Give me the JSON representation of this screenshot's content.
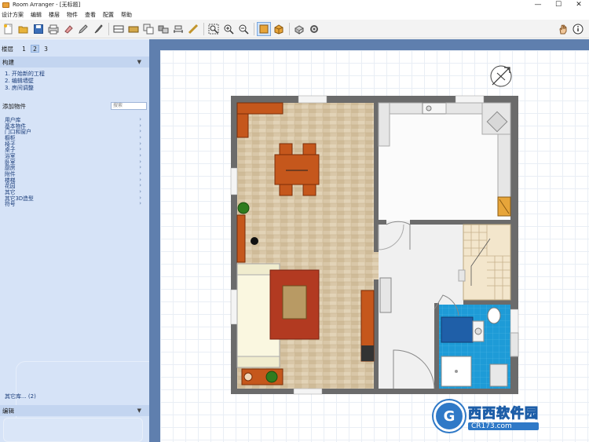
{
  "window": {
    "title": "Room Arranger - [无标题]"
  },
  "controls": {
    "minimize": "—",
    "maximize": "☐",
    "close": "✕"
  },
  "menu": [
    "设计方案",
    "编辑",
    "楼层",
    "物件",
    "查看",
    "帮助",
    "帮助"
  ],
  "menu_labels": {
    "file": "设计方案",
    "edit": "编辑",
    "floor": "楼层",
    "object": "物件",
    "view": "查看",
    "options": "配置",
    "help": "帮助"
  },
  "toolbar": {
    "left_icons": [
      "new-icon",
      "open-icon",
      "save-icon",
      "print-icon",
      "eraser-icon",
      "pencil-icon",
      "brush-icon",
      "wall-icon",
      "floor-tile-icon",
      "copy-icon",
      "group-icon",
      "measure-icon",
      "ruler-icon",
      "zoom-fit-icon",
      "zoom-in-icon",
      "zoom-out-icon",
      "2d-view-icon",
      "3d-view-icon",
      "3d-walk-icon",
      "settings-icon"
    ],
    "right_icons": [
      "hand-icon",
      "info-icon"
    ]
  },
  "sidebar": {
    "floor_label": "楼层",
    "floors": [
      "1",
      "2",
      "3"
    ],
    "active_floor": "2",
    "build_title": "构建",
    "steps": [
      "1.  开始新的工程",
      "2.  编辑墙壁",
      "3.  房间调整"
    ],
    "add_title": "添加物件",
    "search_placeholder": "搜索",
    "categories": [
      "用户库",
      "基本物件",
      "门口和窗户",
      "橱柜",
      "椅子",
      "桌子",
      "浴室",
      "卧室",
      "厨房",
      "附件",
      "楼梯",
      "花园",
      "其它",
      "其它3D造型",
      "符号"
    ],
    "other_library": "其它库...  (2)",
    "edit_title": "编辑"
  },
  "watermark": {
    "logo": "G",
    "main": "西西软件园",
    "sub": "CR173.com"
  },
  "colors": {
    "panel": "#d6e3f7",
    "section": "#c3d5f0",
    "canvas_bg": "#5f7fae",
    "wall": "#6b6b6b",
    "wood_floor": "#d9c7a8",
    "tile": "#1e9bd7"
  }
}
